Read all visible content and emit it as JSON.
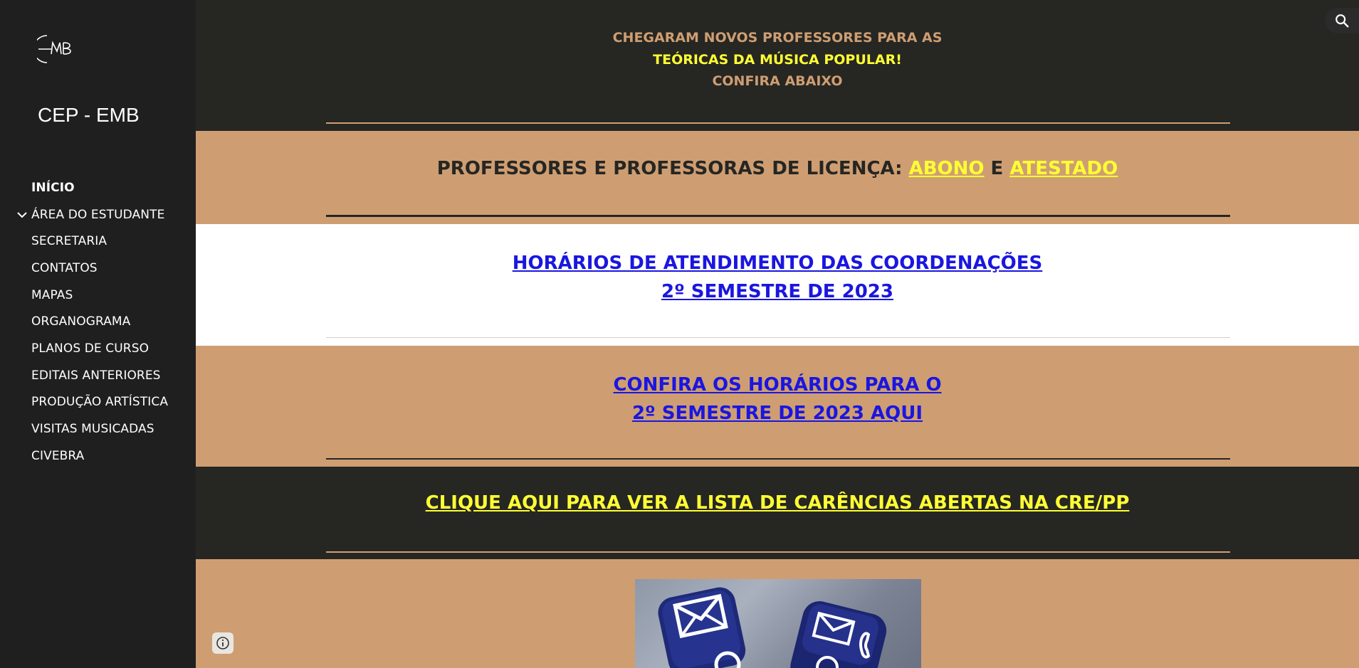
{
  "site": {
    "title": "CEP - EMB",
    "logo_icon": "emb-logo-icon"
  },
  "nav": {
    "items": [
      {
        "label": "INÍCIO",
        "active": true
      },
      {
        "label": "ÁREA DO ESTUDANTE",
        "expandable": true
      },
      {
        "label": "SECRETARIA"
      },
      {
        "label": "CONTATOS"
      },
      {
        "label": "MAPAS"
      },
      {
        "label": "ORGANOGRAMA"
      },
      {
        "label": "PLANOS DE CURSO"
      },
      {
        "label": "EDITAIS ANTERIORES"
      },
      {
        "label": "PRODUÇÃO ARTÍSTICA"
      },
      {
        "label": "VISITAS MUSICADAS"
      },
      {
        "label": "CIVEBRA"
      }
    ]
  },
  "announcement": {
    "line1": "CHEGARAM NOVOS PROFESSORES PARA AS",
    "line2": "TEÓRICAS DA MÚSICA POPULAR!",
    "line3": "CONFIRA ABAIXO"
  },
  "licenca": {
    "prefix": "PROFESSORES E PROFESSORAS DE LICENÇA: ",
    "link1": "ABONO",
    "middle": " E ",
    "link2": "ATESTADO"
  },
  "horarios": {
    "line1": "HORÁRIOS DE ATENDIMENTO DAS COORDENAÇÕES",
    "line2": "2º SEMESTRE DE 2023"
  },
  "confira": {
    "line1": "CONFIRA OS HORÁRIOS PARA O",
    "line2": "2º SEMESTRE DE 2023 AQUI"
  },
  "carencias": {
    "label": "CLIQUE AQUI PARA VER A LISTA DE CARÊNCIAS ABERTAS NA CRE/PP"
  },
  "colors": {
    "tan": "#ce9e72",
    "dark": "#262623",
    "sidebar": "#1f1f1f",
    "yellow": "#ffff33",
    "link_blue": "#1a16e0"
  },
  "icons": {
    "search": "search-icon",
    "info": "info-icon",
    "chevron": "chevron-down-icon"
  }
}
